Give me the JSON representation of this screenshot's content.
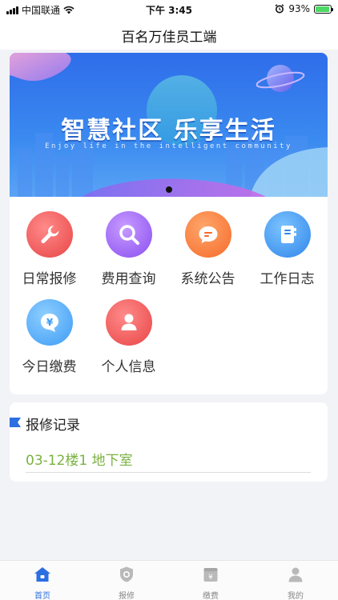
{
  "status_bar": {
    "carrier": "中国联通",
    "time": "下午 3:45",
    "battery": "93%"
  },
  "header": {
    "title": "百名万佳员工端"
  },
  "banner": {
    "headline": "智慧社区  乐享生活",
    "subtitle": "Enjoy life in the intelligent community"
  },
  "menu": [
    {
      "label": "日常报修",
      "icon": "wrench-icon",
      "color": "#f05a5a"
    },
    {
      "label": "费用查询",
      "icon": "search-icon",
      "color": "#a05ef0"
    },
    {
      "label": "系统公告",
      "icon": "chat-bubble-icon",
      "color": "#ff7a3c"
    },
    {
      "label": "工作日志",
      "icon": "notebook-icon",
      "color": "#3d9bf5"
    },
    {
      "label": "今日缴费",
      "icon": "yen-bubble-icon",
      "color": "#3d9bf5"
    },
    {
      "label": "个人信息",
      "icon": "person-icon",
      "color": "#f05a5a"
    }
  ],
  "records": {
    "title": "报修记录",
    "items": [
      "03-12楼1 地下室"
    ]
  },
  "tabs": [
    {
      "label": "首页",
      "icon": "home-icon",
      "active": true
    },
    {
      "label": "报修",
      "icon": "repair-shield-icon",
      "active": false
    },
    {
      "label": "缴费",
      "icon": "wallet-icon",
      "active": false
    },
    {
      "label": "我的",
      "icon": "user-icon",
      "active": false
    }
  ],
  "colors": {
    "accent": "#2b6fe0",
    "record_text": "#7bb241"
  }
}
